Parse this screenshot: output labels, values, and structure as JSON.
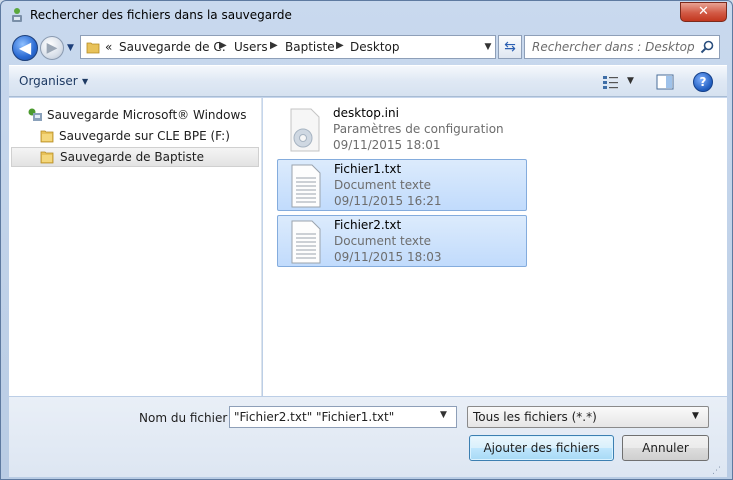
{
  "window": {
    "title": "Rechercher des fichiers dans la sauvegarde",
    "close_label": "✕"
  },
  "nav": {
    "back_glyph": "◀",
    "forward_glyph": "▶",
    "breadcrumb_prefix": "«",
    "breadcrumb": [
      "Sauvegarde de C:",
      "Users",
      "Baptiste",
      "Desktop"
    ],
    "search_placeholder": "Rechercher dans : Desktop"
  },
  "toolbar": {
    "organize_label": "Organiser",
    "help_label": "?"
  },
  "tree": [
    {
      "label": "Sauvegarde Microsoft® Windows",
      "icon": "backup-icon",
      "selected": false
    },
    {
      "label": "Sauvegarde sur CLE BPE (F:)",
      "icon": "folder-icon",
      "selected": false
    },
    {
      "label": "Sauvegarde de Baptiste",
      "icon": "folder-icon",
      "selected": true
    }
  ],
  "files": [
    {
      "name": "desktop.ini",
      "type": "Paramètres de configuration",
      "date": "09/11/2015 18:01",
      "icon": "settings-file-icon",
      "selected": false
    },
    {
      "name": "Fichier1.txt",
      "type": "Document texte",
      "date": "09/11/2015 16:21",
      "icon": "text-file-icon",
      "selected": true
    },
    {
      "name": "Fichier2.txt",
      "type": "Document texte",
      "date": "09/11/2015 18:03",
      "icon": "text-file-icon",
      "selected": true
    }
  ],
  "footer": {
    "filename_label": "Nom du fichier :",
    "filename_value": "\"Fichier2.txt\" \"Fichier1.txt\"",
    "filter_value": "Tous les fichiers (*.*)",
    "add_button": "Ajouter des fichiers",
    "cancel_button": "Annuler"
  },
  "colors": {
    "selection": "#c1dbfc",
    "selection_border": "#84acdd",
    "close": "#c2371f"
  }
}
